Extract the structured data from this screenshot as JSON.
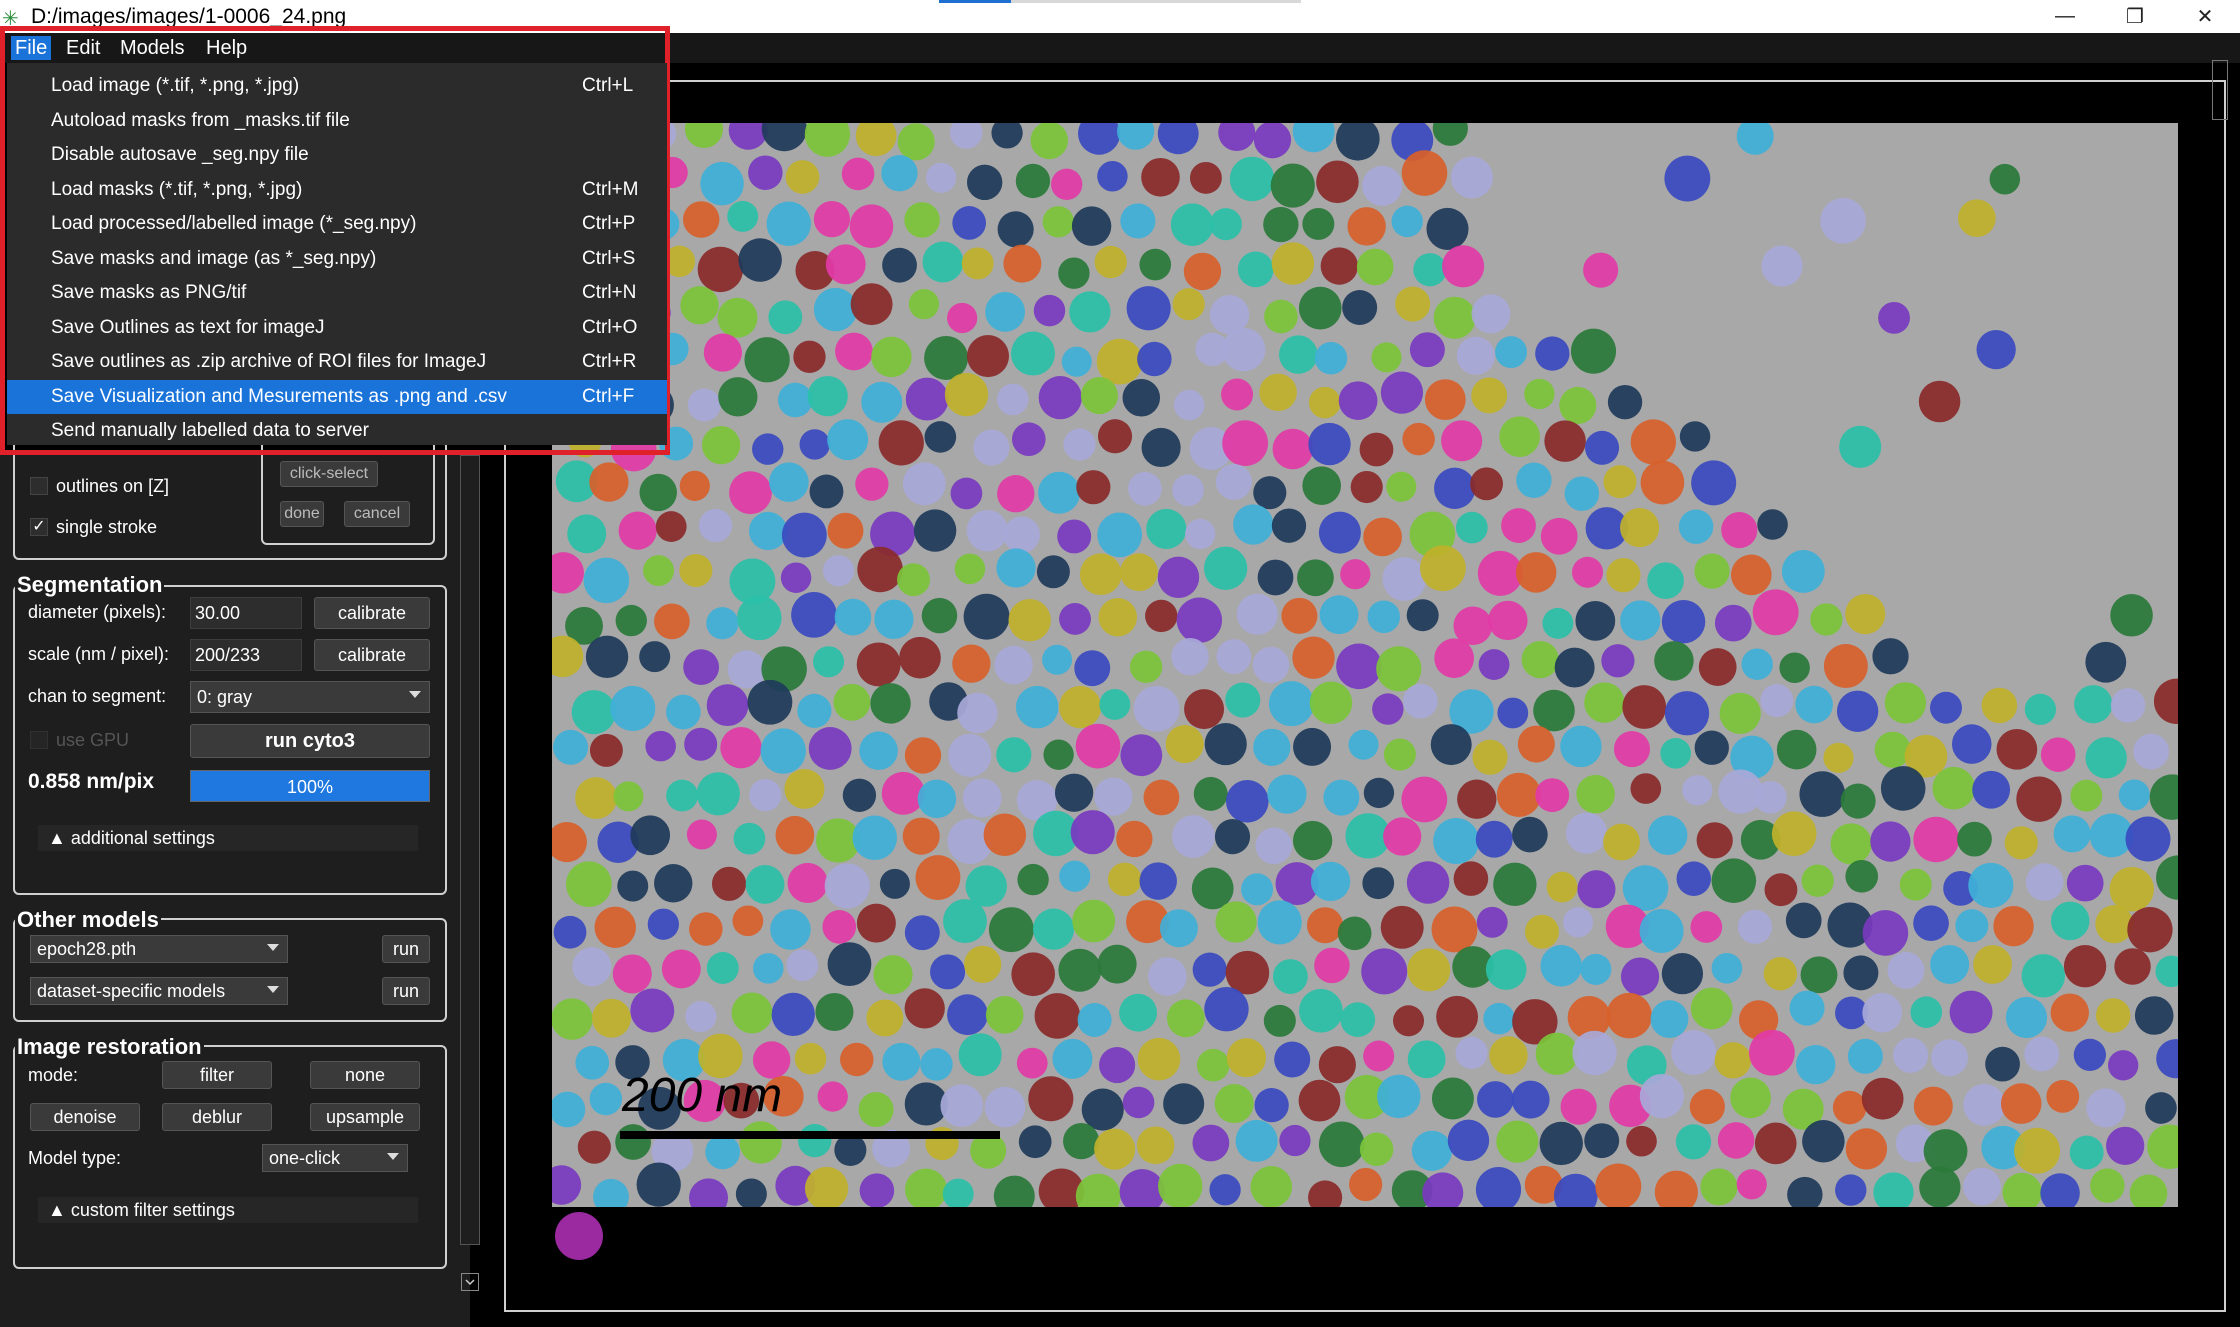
{
  "window": {
    "title": "D:/images/images/1-0006_24.png",
    "minimize": "—",
    "restore": "❐",
    "close": "✕"
  },
  "menubar": [
    "File",
    "Edit",
    "Models",
    "Help"
  ],
  "file_menu": [
    {
      "label": "Load image (*.tif, *.png, *.jpg)",
      "shortcut": "Ctrl+L"
    },
    {
      "label": "Autoload masks from _masks.tif file",
      "shortcut": ""
    },
    {
      "label": "Disable autosave _seg.npy file",
      "shortcut": ""
    },
    {
      "label": "Load masks (*.tif, *.png, *.jpg)",
      "shortcut": "Ctrl+M"
    },
    {
      "label": "Load processed/labelled image (*_seg.npy)",
      "shortcut": "Ctrl+P"
    },
    {
      "label": "Save masks and image (as *_seg.npy)",
      "shortcut": "Ctrl+S"
    },
    {
      "label": "Save masks as PNG/tif",
      "shortcut": "Ctrl+N"
    },
    {
      "label": "Save Outlines as text for imageJ",
      "shortcut": "Ctrl+O"
    },
    {
      "label": "Save outlines as .zip archive of ROI files for ImageJ",
      "shortcut": "Ctrl+R"
    },
    {
      "label": "Save Visualization and Mesurements as .png and .csv",
      "shortcut": "Ctrl+F",
      "highlighted": true
    },
    {
      "label": "Send manually labelled data to server",
      "shortcut": ""
    }
  ],
  "drawing": {
    "outlines": "outlines on [Z]",
    "single_stroke": "single stroke",
    "single_stroke_checked": "✓",
    "click_select": "click-select",
    "done": "done",
    "cancel": "cancel"
  },
  "segmentation": {
    "title": "Segmentation",
    "diameter_label": "diameter (pixels):",
    "diameter_value": "30.00",
    "scale_label": "scale (nm / pixel):",
    "scale_value": "200/233",
    "calibrate": "calibrate",
    "chan_label": "chan to segment:",
    "chan_value": "0: gray",
    "use_gpu": "use GPU",
    "run": "run cyto3",
    "nm_per_pix": "0.858 nm/pix",
    "progress_text": "100%",
    "progress": 1.0,
    "additional": "▲ additional settings"
  },
  "other_models": {
    "title": "Other models",
    "model1": "epoch28.pth",
    "model2": "dataset-specific models",
    "run": "run"
  },
  "restoration": {
    "title": "Image restoration",
    "mode_label": "mode:",
    "filter": "filter",
    "none": "none",
    "denoise": "denoise",
    "deblur": "deblur",
    "upsample": "upsample",
    "model_type_label": "Model type:",
    "model_type_value": "one-click",
    "custom": "▲ custom filter settings"
  },
  "viewer": {
    "scale_bar_text": "200 nm",
    "palette": [
      "#e23aa7",
      "#3fb0d8",
      "#7cc43a",
      "#c0b12a",
      "#2a7a3a",
      "#7a3ac0",
      "#d8602a",
      "#3a4ac0",
      "#2ac0a8",
      "#a8a8d8",
      "#8a2a2a",
      "#1e3a5a"
    ]
  }
}
